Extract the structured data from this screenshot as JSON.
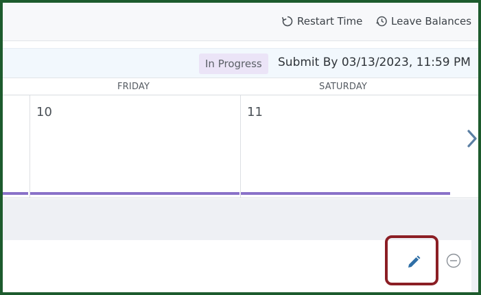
{
  "toolbar": {
    "restart_label": "Restart Time",
    "leave_label": "Leave Balances"
  },
  "status": {
    "badge": "In Progress",
    "submit_text": "Submit By 03/13/2023, 11:59 PM"
  },
  "calendar": {
    "days": [
      {
        "name": "FRIDAY",
        "number": "10"
      },
      {
        "name": "SATURDAY",
        "number": "11"
      }
    ]
  },
  "icons": {
    "restart": "restart-icon",
    "leave": "clock-history-icon",
    "next": "chevron-right-icon",
    "edit": "pencil-icon",
    "remove": "minus-circle-icon"
  },
  "colors": {
    "frame_border": "#1d5b2d",
    "highlight": "#8b1e24",
    "day_bar": "#8a72c8",
    "accent_blue": "#2f6fa6"
  }
}
